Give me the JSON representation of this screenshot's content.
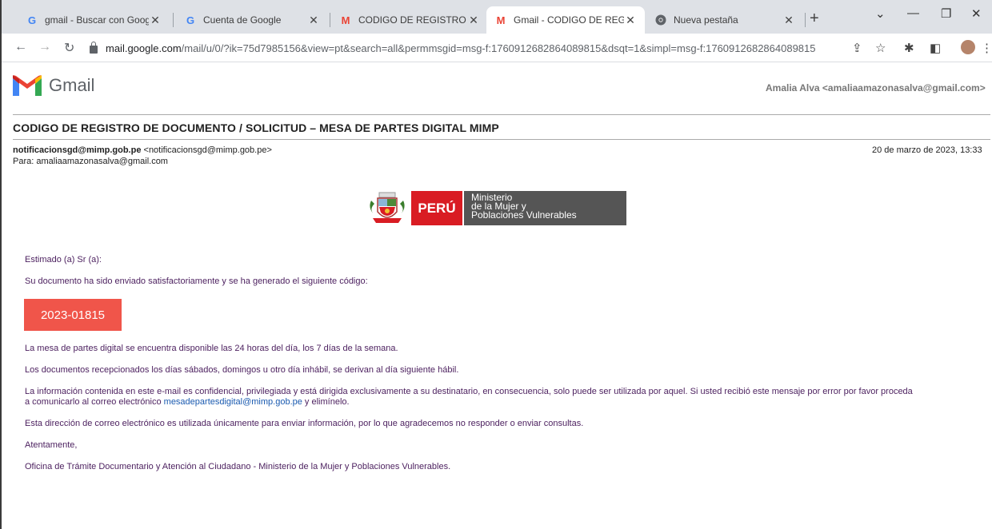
{
  "browser": {
    "tabs": [
      {
        "title": "gmail - Buscar con Google",
        "favicon": "G",
        "favicon_color": "#4285f4"
      },
      {
        "title": "Cuenta de Google",
        "favicon": "G",
        "favicon_color": "#4285f4"
      },
      {
        "title": "CODIGO DE REGISTRO DE DC",
        "favicon": "M",
        "favicon_color": "#ea4335"
      },
      {
        "title": "Gmail - CODIGO DE REGISTR",
        "favicon": "M",
        "favicon_color": "#ea4335"
      },
      {
        "title": "Nueva pestaña",
        "favicon": "chrome-icon",
        "favicon_color": "#5f6368"
      }
    ],
    "active_tab": 3,
    "url_host": "mail.google.com",
    "url_path": "/mail/u/0/?ik=75d7985156&view=pt&search=all&permmsgid=msg-f:1760912682864089815&dsqt=1&simpl=msg-f:1760912682864089815"
  },
  "gmail": {
    "app_name": "Gmail",
    "account": "Amalia Alva <amaliaamazonasalva@gmail.com>"
  },
  "email": {
    "subject": "CODIGO DE REGISTRO DE DOCUMENTO / SOLICITUD – MESA DE PARTES DIGITAL MIMP",
    "sender_email": "notificacionsgd@mimp.gob.pe",
    "sender_addr": "<notificacionsgd@mimp.gob.pe>",
    "to": "Para: amaliaamazonasalva@gmail.com",
    "date": "20 de marzo de 2023, 13:33",
    "banner": {
      "country": "PERÚ",
      "ministry_line1": "Ministerio",
      "ministry_line2": "de la Mujer y",
      "ministry_line3": "Poblaciones Vulnerables"
    },
    "greeting": "Estimado (a) Sr (a):",
    "intro": "Su documento ha sido enviado satisfactoriamente y se ha generado el siguiente código:",
    "code": "2023-01815",
    "p1": "La mesa de partes digital se encuentra disponible las 24 horas del día, los 7 días de la semana.",
    "p2": "Los documentos recepcionados los días sábados, domingos u otro día inhábil, se derivan al día siguiente hábil.",
    "p3_line1": "La información contenida en este e-mail es confidencial, privilegiada y está dirigida exclusivamente a su destinatario, en consecuencia, solo puede ser utilizada por aquel. Si usted recibió este mensaje por error por favor proceda",
    "p3_line2_pre": "a comunicarlo al correo electrónico",
    "p3_link": "mesadepartesdigital@mimp.gob.pe",
    "p3_line2_post": "y elimínelo.",
    "p4": "Esta dirección de correo electrónico es utilizada únicamente para enviar información, por lo que agradecemos no responder o enviar consultas.",
    "closing": "Atentamente,",
    "signature": "Oficina de Trámite Documentario y Atención al Ciudadano - Ministerio de la Mujer y Poblaciones Vulnerables."
  }
}
